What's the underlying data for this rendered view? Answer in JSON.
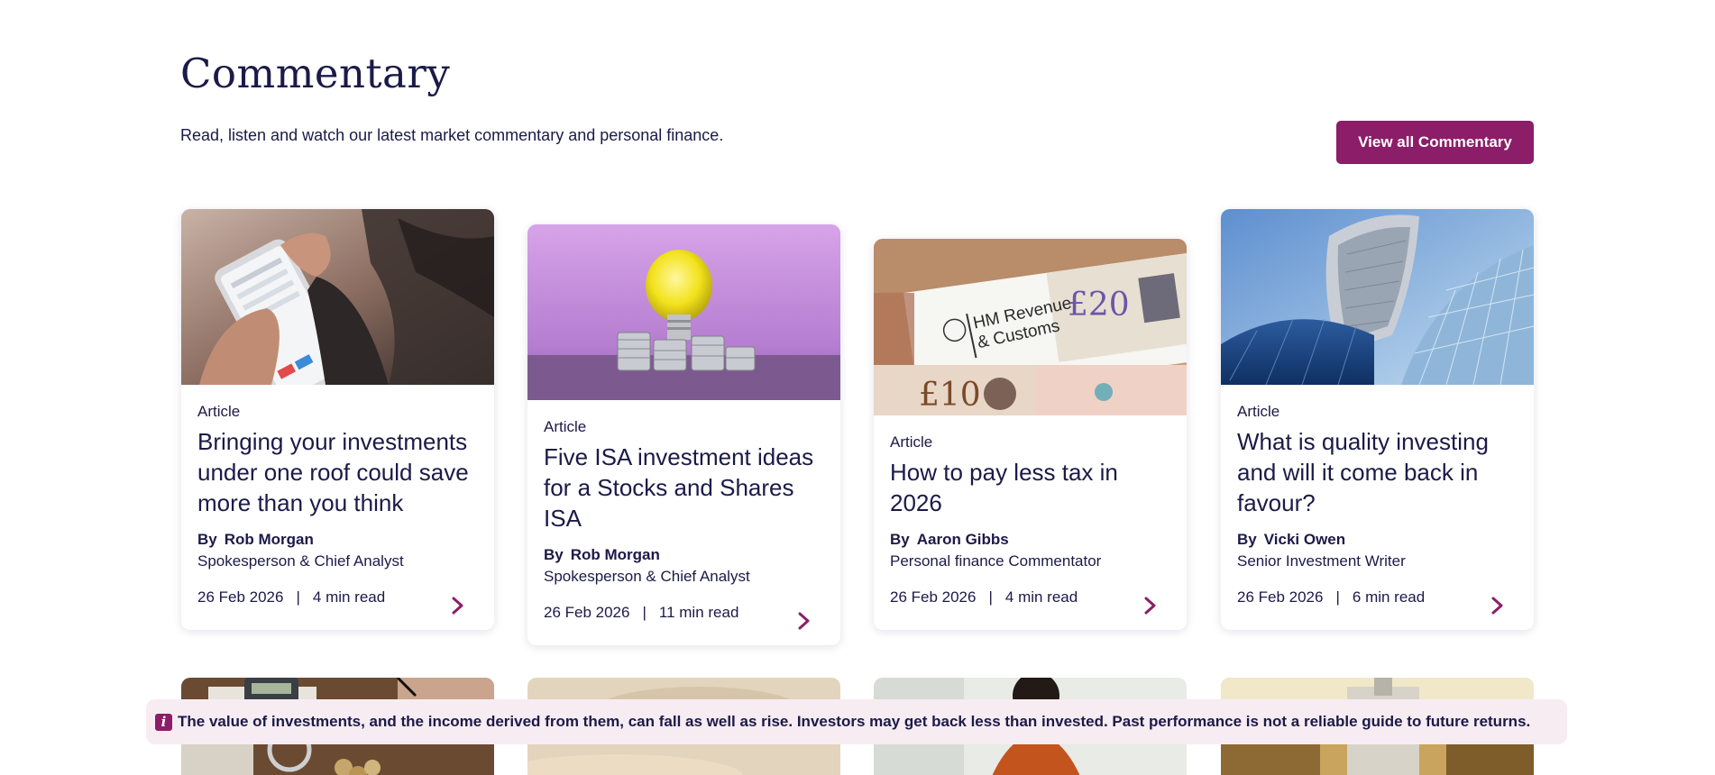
{
  "section": {
    "title": "Commentary",
    "intro": "Read, listen and watch our latest market commentary and personal finance.",
    "view_all_label": "View all Commentary"
  },
  "cards": [
    {
      "type": "Article",
      "title": "Bringing your investments under one roof could save more than you think",
      "by": "By",
      "author": "Rob Morgan",
      "role": "Spokesperson & Chief Analyst",
      "date": "26 Feb 2026",
      "read_time": "4 min read",
      "image": "woman-using-smartphone-photo"
    },
    {
      "type": "Article",
      "title": "Five ISA investment ideas for a Stocks and Shares ISA",
      "by": "By",
      "author": "Rob Morgan",
      "role": "Spokesperson & Chief Analyst",
      "date": "26 Feb 2026",
      "read_time": "11 min read",
      "image": "lightbulb-and-coins-photo"
    },
    {
      "type": "Article",
      "title": "How to pay less tax in 2026",
      "by": "By",
      "author": "Aaron Gibbs",
      "role": "Personal finance Commentator",
      "date": "26 Feb 2026",
      "read_time": "4 min read",
      "image": "hmrc-letter-and-banknotes-photo"
    },
    {
      "type": "Article",
      "title": "What is quality investing and will it come back in favour?",
      "by": "By",
      "author": "Vicki Owen",
      "role": "Senior Investment Writer",
      "date": "26 Feb 2026",
      "read_time": "6 min read",
      "image": "glass-skyscraper-photo"
    }
  ],
  "hmrc_image_text": {
    "line1": "HM Revenue",
    "line2": "& Customs",
    "note20": "£20",
    "note10": "£10"
  },
  "risk_warning": {
    "icon": "info-icon",
    "icon_glyph": "i",
    "text": "The value of investments, and the income derived from them, can fall as well as rise. Investors may get back less than invested. Past performance is not a reliable guide to future returns."
  },
  "separator": "|",
  "colors": {
    "brand_plum": "#8c1d68",
    "navy_text": "#1b1a48",
    "banner_bg": "#f7ecf2"
  }
}
